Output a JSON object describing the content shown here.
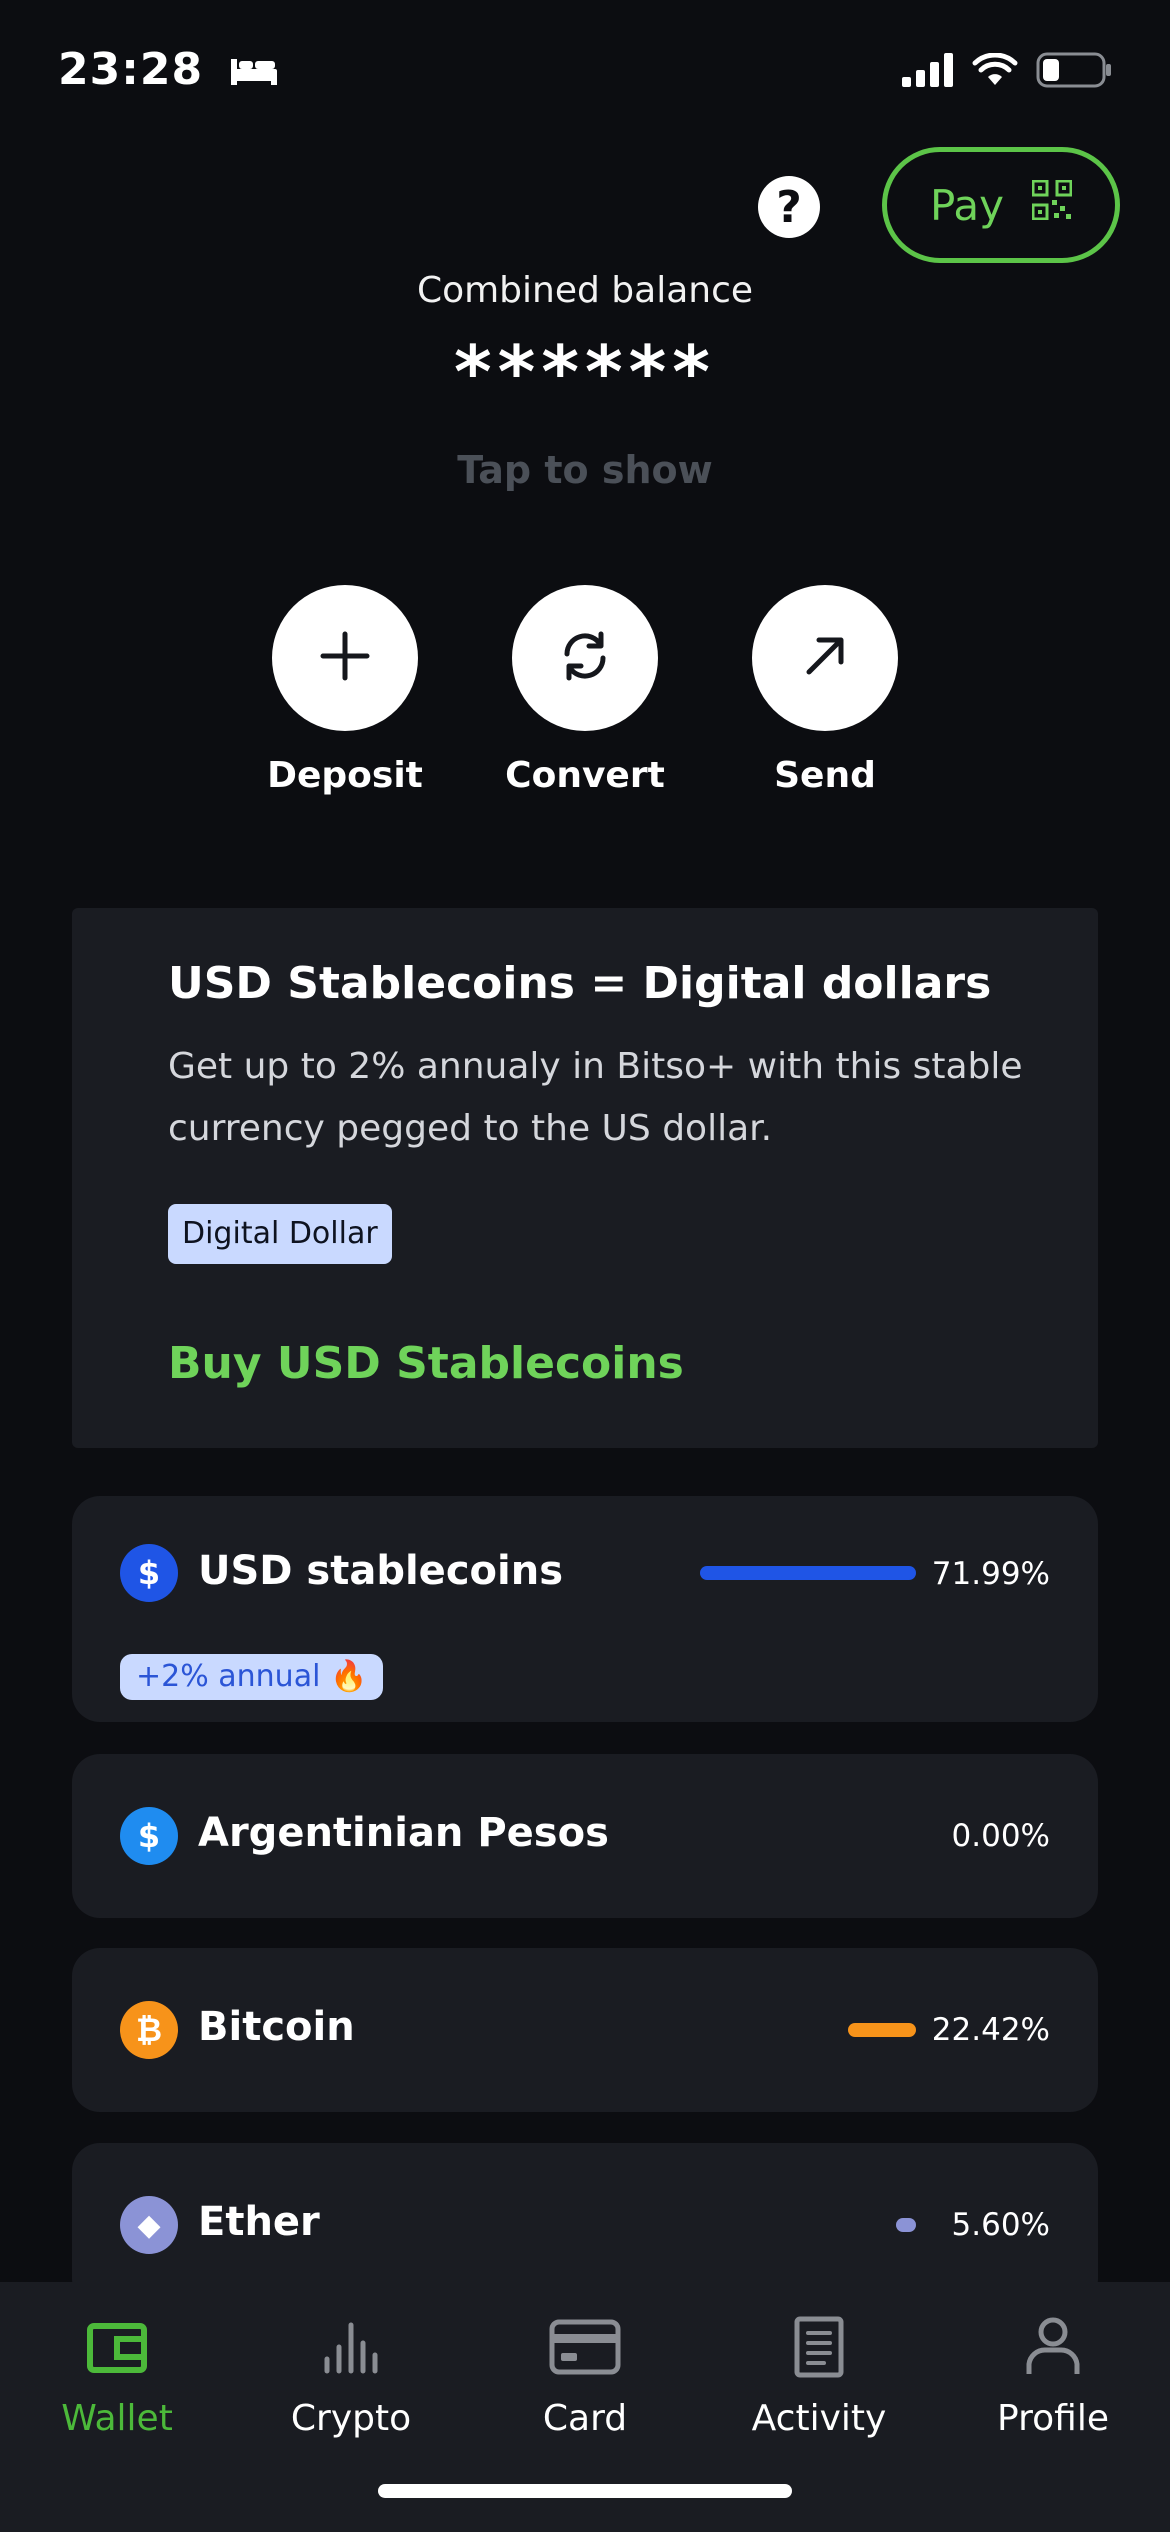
{
  "status": {
    "time": "23:28"
  },
  "header": {
    "help_symbol": "?",
    "pay_label": "Pay"
  },
  "balance": {
    "label": "Combined balance",
    "value": "******",
    "tap_hint": "Tap to show"
  },
  "actions": [
    {
      "label": "Deposit",
      "icon": "plus-icon"
    },
    {
      "label": "Convert",
      "icon": "refresh-icon"
    },
    {
      "label": "Send",
      "icon": "arrow-up-right-icon"
    }
  ],
  "promo": {
    "title": "USD Stablecoins = Digital dollars",
    "description": "Get up to 2% annualy in Bitso+ with this stable currency pegged to the US dollar.",
    "tag": "Digital Dollar",
    "cta": "Buy USD Stablecoins"
  },
  "assets": [
    {
      "name": "USD stablecoins",
      "percent_label": "71.99%",
      "share": 0.7199,
      "color": "#1f55e6",
      "icon": "dollar-icon",
      "icon_text": "$",
      "badge": "+2% annual 🔥"
    },
    {
      "name": "Argentinian Pesos",
      "percent_label": "0.00%",
      "share": 0.0,
      "color": "#1f8cf0",
      "icon": "dollar-icon",
      "icon_text": "$"
    },
    {
      "name": "Bitcoin",
      "percent_label": "22.42%",
      "share": 0.2242,
      "color": "#f7931a",
      "icon": "bitcoin-icon",
      "icon_text": "₿"
    },
    {
      "name": "Ether",
      "percent_label": "5.60%",
      "share": 0.056,
      "color": "#8b93d6",
      "icon": "ether-icon",
      "icon_text": "◆"
    }
  ],
  "tabs": [
    {
      "label": "Wallet",
      "active": true,
      "icon": "wallet-icon"
    },
    {
      "label": "Crypto",
      "active": false,
      "icon": "chart-icon"
    },
    {
      "label": "Card",
      "active": false,
      "icon": "card-icon"
    },
    {
      "label": "Activity",
      "active": false,
      "icon": "document-icon"
    },
    {
      "label": "Profile",
      "active": false,
      "icon": "person-icon"
    }
  ],
  "colors": {
    "accent_green": "#6fd35a",
    "background": "#0c0d11",
    "card": "#1a1c22"
  }
}
